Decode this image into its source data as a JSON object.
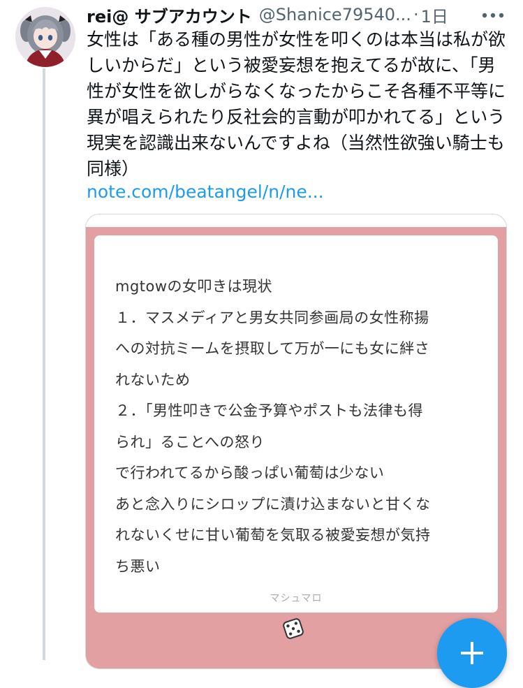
{
  "tweet": {
    "display_name": "rei@ サブアカウント",
    "handle": "@Shanice79540...",
    "time": "1日",
    "time_separator": "·",
    "text": "女性は「ある種の男性が女性を叩くのは本当は私が欲しいからだ」という被愛妄想を抱えてるが故に、「男性が女性を欲しがらなくなったからこそ各種不平等に異が唱えられたり反社会的言動が叩かれてる」という現実を認識出来ないんですよね（当然性欲強い騎士も同様）",
    "link": "note.com/beatangel/n/ne..."
  },
  "card": {
    "lines": [
      "mgtowの女叩きは現状",
      "１．マスメディアと男女共同参画局の女性称揚",
      "への対抗ミームを摂取して万が一にも女に絆さ",
      "れないため",
      "２．「男性叩きで公金予算やポストも法律も得",
      "られ」ることへの怒り",
      "で行われてるから酸っぱい葡萄は少ない",
      "あと念入りにシロップに漬け込まないと甘くな",
      "れないくせに甘い葡萄を気取る被愛妄想が気持",
      "ち悪い"
    ],
    "source": "マシュマロ",
    "accent_color": "#e3a0a3"
  },
  "icons": {
    "more": "more-options-icon",
    "avatar": "avatar",
    "card_logo": "dice-icon",
    "compose": "plus-icon"
  },
  "colors": {
    "link": "#1d9bf0",
    "secondary_text": "#536471",
    "thread_line": "#cfd9de"
  }
}
